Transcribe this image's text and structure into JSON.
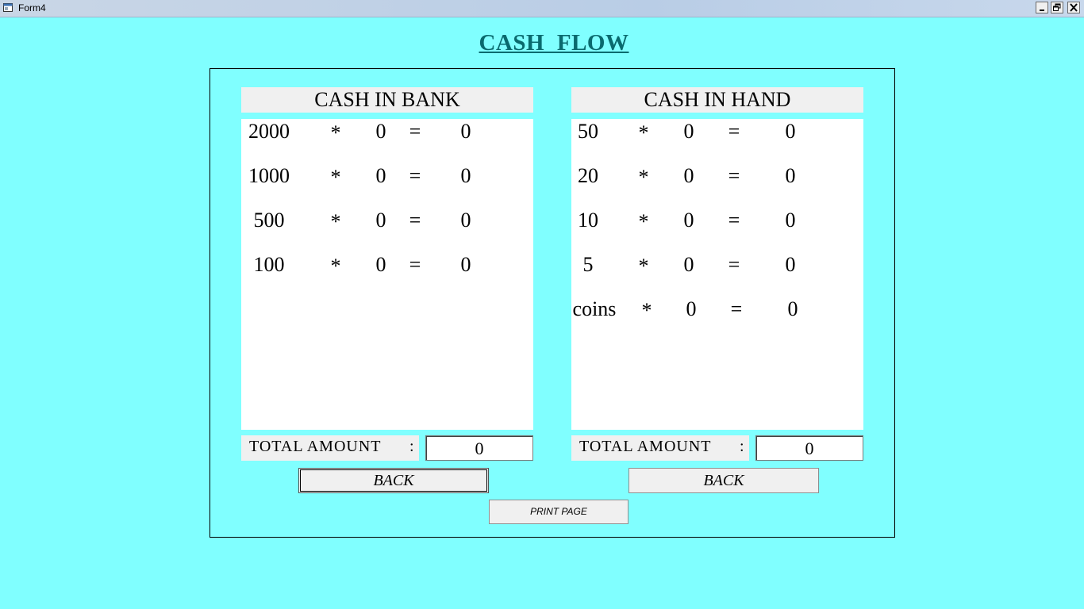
{
  "window": {
    "title": "Form4"
  },
  "heading": "CASH  FLOW",
  "bank": {
    "header": "CASH IN BANK",
    "rows": [
      {
        "denom": "2000",
        "op": "*",
        "qty": "0",
        "eq": "=",
        "result": "0"
      },
      {
        "denom": "1000",
        "op": "*",
        "qty": "0",
        "eq": "=",
        "result": "0"
      },
      {
        "denom": "500",
        "op": "*",
        "qty": "0",
        "eq": "=",
        "result": "0"
      },
      {
        "denom": "100",
        "op": "*",
        "qty": "0",
        "eq": "=",
        "result": "0"
      }
    ],
    "total_label": "TOTAL  AMOUNT",
    "total_colon": ":",
    "total_value": "0",
    "back_label": "BACK"
  },
  "hand": {
    "header": "CASH IN HAND",
    "rows": [
      {
        "denom": "50",
        "op": "*",
        "qty": "0",
        "eq": "=",
        "result": "0"
      },
      {
        "denom": "20",
        "op": "*",
        "qty": "0",
        "eq": "=",
        "result": "0"
      },
      {
        "denom": "10",
        "op": "*",
        "qty": "0",
        "eq": "=",
        "result": "0"
      },
      {
        "denom": "5",
        "op": "*",
        "qty": "0",
        "eq": "=",
        "result": "0"
      },
      {
        "denom": "coins",
        "op": "*",
        "qty": "0",
        "eq": "=",
        "result": "0"
      }
    ],
    "total_label": "TOTAL  AMOUNT",
    "total_colon": ":",
    "total_value": "0",
    "back_label": "BACK"
  },
  "print_label": "PRINT PAGE",
  "icons": {
    "app": "form-icon",
    "minimize": "minimize-icon",
    "restore": "restore-icon",
    "close": "close-icon"
  }
}
